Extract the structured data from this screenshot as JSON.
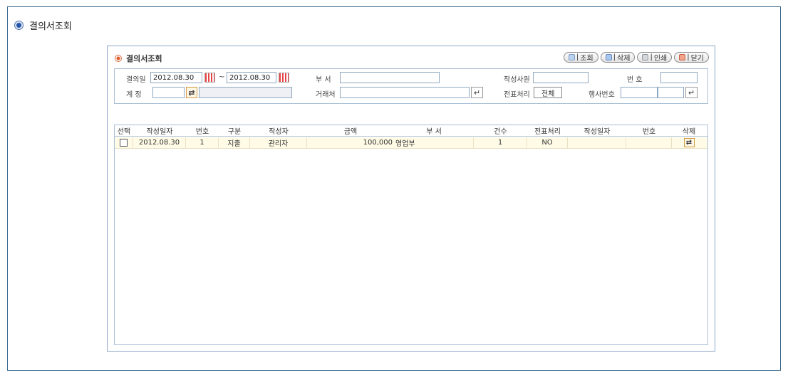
{
  "page": {
    "title": "결의서조회"
  },
  "panel": {
    "title": "결의서조회"
  },
  "toolbar": [
    {
      "label": "조회",
      "icon": "search-icon"
    },
    {
      "label": "삭제",
      "icon": "delete-icon"
    },
    {
      "label": "인쇄",
      "icon": "print-icon"
    },
    {
      "label": "닫기",
      "icon": "close-icon"
    }
  ],
  "search": {
    "date_label": "결의일",
    "date_from": "2012.08.30",
    "date_sep": "~",
    "date_to": "2012.08.30",
    "dept_label": "부  서",
    "dept_value": "",
    "writer_label": "작성사원",
    "writer_value": "",
    "number_label": "번    호",
    "number_value": "",
    "account_label": "계  정",
    "account_code": "",
    "account_name": "",
    "client_label": "거래처",
    "client_value": "",
    "slip_label": "전표처리",
    "slip_value": "전체",
    "event_label": "행사번호",
    "event_value_1": "",
    "event_value_2": ""
  },
  "grid": {
    "columns": [
      "선택",
      "작성일자",
      "번호",
      "구분",
      "작성자",
      "금액",
      "부  서",
      "건수",
      "전표처리",
      "작성일자",
      "번호",
      "삭제"
    ],
    "rows": [
      {
        "date": "2012.08.30",
        "no": "1",
        "type": "지출",
        "writer": "관리자",
        "amount": "100,000",
        "dept": "영업부",
        "count": "1",
        "slip": "NO",
        "slip_date": "",
        "slip_no": ""
      }
    ]
  }
}
